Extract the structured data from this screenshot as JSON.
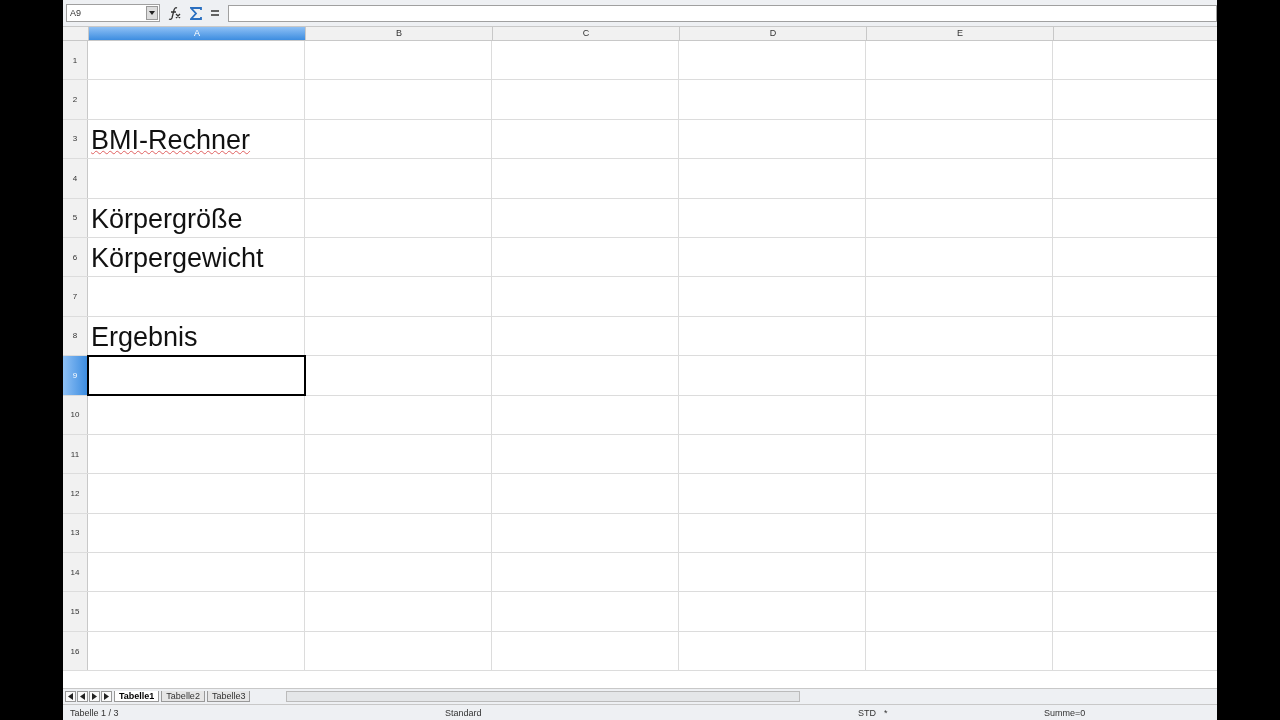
{
  "name_box": "A9",
  "columns": [
    {
      "label": "A",
      "selected": true
    },
    {
      "label": "B",
      "selected": false
    },
    {
      "label": "C",
      "selected": false
    },
    {
      "label": "D",
      "selected": false
    },
    {
      "label": "E",
      "selected": false
    }
  ],
  "rows": [
    {
      "number": "1",
      "selected": false
    },
    {
      "number": "2",
      "selected": false
    },
    {
      "number": "3",
      "selected": false,
      "text": "BMI-Rechner",
      "misspelled": true
    },
    {
      "number": "4",
      "selected": false
    },
    {
      "number": "5",
      "selected": false,
      "text": "Körpergröße",
      "misspelled": false
    },
    {
      "number": "6",
      "selected": false,
      "text": "Körpergewicht",
      "misspelled": false
    },
    {
      "number": "7",
      "selected": false
    },
    {
      "number": "8",
      "selected": false,
      "text": "Ergebnis",
      "misspelled": false
    },
    {
      "number": "9",
      "selected": true
    },
    {
      "number": "10",
      "selected": false
    },
    {
      "number": "11",
      "selected": false
    },
    {
      "number": "12",
      "selected": false
    },
    {
      "number": "13",
      "selected": false
    },
    {
      "number": "14",
      "selected": false
    },
    {
      "number": "15",
      "selected": false
    },
    {
      "number": "16",
      "selected": false
    }
  ],
  "sheet_tabs": [
    {
      "label": "Tabelle1",
      "selected": true
    },
    {
      "label": "Tabelle2",
      "selected": false
    },
    {
      "label": "Tabelle3",
      "selected": false
    }
  ],
  "status_bar": {
    "sheet": "Tabelle 1 / 3",
    "style": "Standard",
    "mode": "STD",
    "modified": "*",
    "sum": "Summe=0"
  }
}
